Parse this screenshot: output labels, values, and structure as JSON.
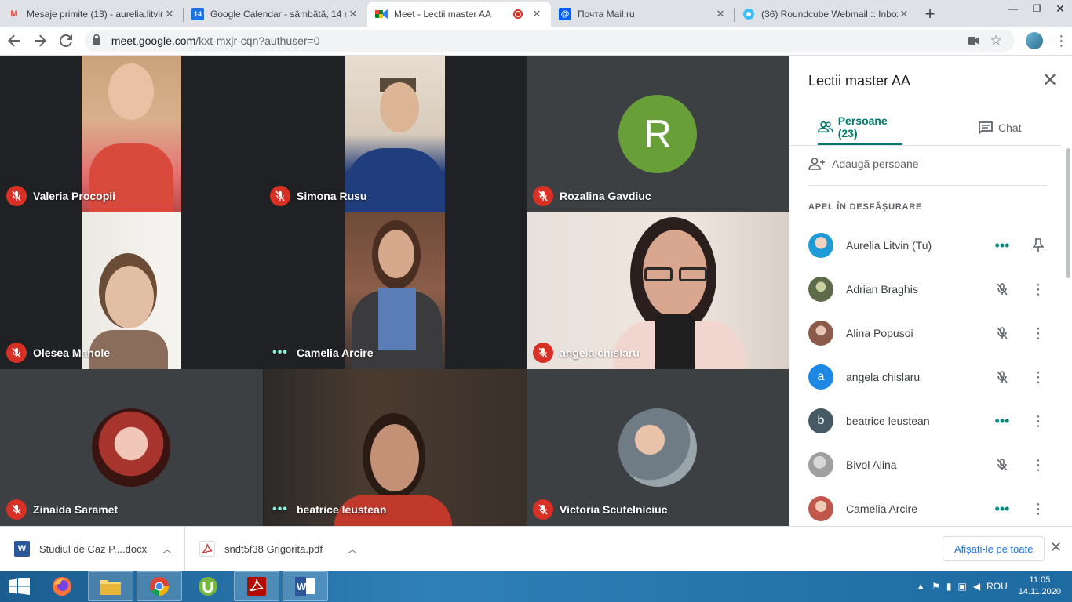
{
  "browser": {
    "tabs": [
      {
        "title": "Mesaje primite (13) - aurelia.litvin",
        "favicon": "gmail-icon",
        "fav_text": "M",
        "fav_color": "#ea4335"
      },
      {
        "title": "Google Calendar - sâmbătă, 14 n",
        "favicon": "calendar-icon",
        "fav_text": "14",
        "fav_color": "#1a73e8"
      },
      {
        "title": "Meet - Lectii master AA",
        "favicon": "meet-icon",
        "fav_text": "",
        "fav_color": "#00832d",
        "active": true
      },
      {
        "title": "Почта Mail.ru",
        "favicon": "mailru-icon",
        "fav_text": "@",
        "fav_color": "#005ff9"
      },
      {
        "title": "(36) Roundcube Webmail :: Inbox",
        "favicon": "roundcube-icon",
        "fav_text": "",
        "fav_color": "#37beff"
      }
    ],
    "url_host": "meet.google.com",
    "url_path": "/kxt-mxjr-cqn?authuser=0"
  },
  "meet": {
    "tiles": [
      {
        "name": "Valeria Procopii",
        "status": "muted"
      },
      {
        "name": "Simona Rusu",
        "status": "muted"
      },
      {
        "name": "Rozalina Gavdiuc",
        "status": "muted",
        "avatar_letter": "R"
      },
      {
        "name": "Olesea Manole",
        "status": "muted"
      },
      {
        "name": "Camelia Arcire",
        "status": "speaking"
      },
      {
        "name": "angela chislaru",
        "status": "muted"
      },
      {
        "name": "Zinaida Saramet",
        "status": "muted"
      },
      {
        "name": "beatrice leustean",
        "status": "speaking"
      },
      {
        "name": "Victoria Scutelniciuc",
        "status": "muted"
      }
    ]
  },
  "panel": {
    "title": "Lectii master AA",
    "people_tab": "Persoane (23)",
    "chat_tab": "Chat",
    "add_people": "Adaugă persoane",
    "section": "APEL ÎN DESFĂȘURARE",
    "participants": [
      {
        "name": "Aurelia Litvin (Tu)",
        "status": "speaking",
        "action": "pin",
        "avatar": "photo",
        "color": "#4aa3d8"
      },
      {
        "name": "Adrian Braghis",
        "status": "muted",
        "action": "more",
        "avatar": "photo",
        "color": "#6d7b5a"
      },
      {
        "name": "Alina Popusoi",
        "status": "muted",
        "action": "more",
        "avatar": "photo",
        "color": "#b07a6a"
      },
      {
        "name": "angela chislaru",
        "status": "muted",
        "action": "more",
        "avatar": "a",
        "color": "#1e88e5"
      },
      {
        "name": "beatrice leustean",
        "status": "speaking",
        "action": "more",
        "avatar": "b",
        "color": "#455a64"
      },
      {
        "name": "Bivol Alina",
        "status": "muted",
        "action": "more",
        "avatar": "photo",
        "color": "#9e9e9e"
      },
      {
        "name": "Camelia Arcire",
        "status": "speaking",
        "action": "more",
        "avatar": "photo",
        "color": "#c66a5a"
      }
    ]
  },
  "downloads": {
    "items": [
      {
        "name": "Studiul de Caz P....docx",
        "type": "word-file-icon",
        "color": "#2b579a",
        "glyph": "W"
      },
      {
        "name": "sndt5f38 Grigorita.pdf",
        "type": "pdf-file-icon",
        "color": "#d32f2f",
        "glyph": "A"
      }
    ],
    "show_all": "Afișați-le pe toate"
  },
  "taskbar": {
    "lang": "ROU",
    "time": "11:05",
    "date": "14.11.2020"
  }
}
